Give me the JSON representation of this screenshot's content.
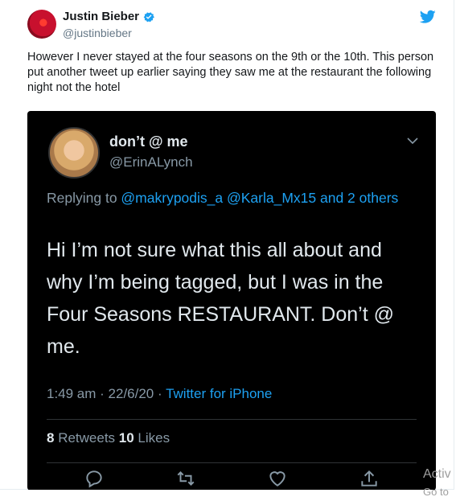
{
  "tweet": {
    "name": "Justin Bieber",
    "handle": "@justinbieber",
    "text": "However I never stayed at the four seasons on the 9th or the 10th. This person put another tweet up earlier saying they saw me at the restaurant the following night not the hotel"
  },
  "embedded": {
    "name": "don’t @ me",
    "handle": "@ErinALynch",
    "replying_prefix": "Replying to ",
    "replying_links": "@makrypodis_a @Karla_Mx15 and 2 others",
    "text": "Hi I’m not sure what this all about and why I’m being tagged, but I was in the Four Seasons RESTAURANT. Don’t @ me.",
    "time": "1:49 am · 22/6/20 · ",
    "client": "Twitter for iPhone",
    "retweets_count": "8",
    "retweets_label": " Retweets ",
    "likes_count": "10",
    "likes_label": " Likes"
  },
  "watermark": {
    "line1": "Activ",
    "line2": "Go to"
  },
  "colors": {
    "accent": "#1da1f2",
    "embed_bg": "#000000",
    "text_dim": "#8899a6"
  },
  "icons": [
    "verified-icon",
    "twitter-bird-icon",
    "chevron-down-icon",
    "reply-icon",
    "retweet-icon",
    "like-icon",
    "share-icon"
  ]
}
